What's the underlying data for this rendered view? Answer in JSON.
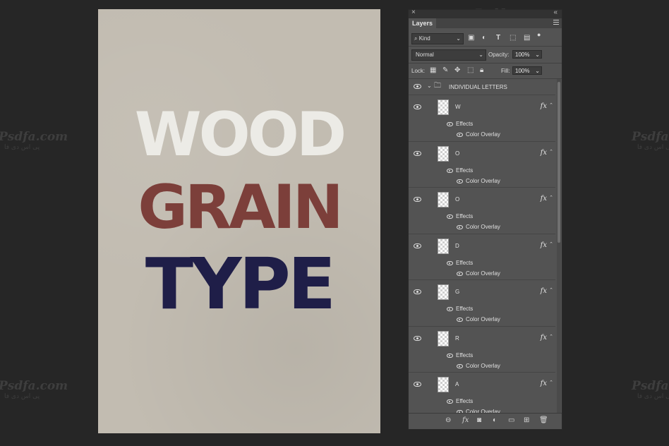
{
  "watermark": {
    "brand": "Psdfa.com",
    "sub": "پی اس دی فا"
  },
  "canvas": {
    "words": [
      "WOOD",
      "GRAIN",
      "TYPE"
    ],
    "colors": {
      "wood": "#ecebe6",
      "grain": "#7c3f3a",
      "type": "#1f1e48"
    }
  },
  "panel": {
    "close": "×",
    "collapse": "«",
    "tab": "Layers",
    "filter": {
      "label": "Kind",
      "icons": [
        "image-icon",
        "adjustment-icon",
        "type-icon",
        "shape-icon",
        "smartobject-icon",
        "toggle-icon"
      ]
    },
    "blend_mode": "Normal",
    "opacity_label": "Opacity:",
    "opacity_value": "100%",
    "lock_label": "Lock:",
    "fill_label": "Fill:",
    "fill_value": "100%",
    "group_name": "INDIVIDUAL LETTERS",
    "layers": [
      {
        "name": "W",
        "fx": "fx",
        "effects": "Effects",
        "effect_item": "Color Overlay"
      },
      {
        "name": "O",
        "fx": "fx",
        "effects": "Effects",
        "effect_item": "Color Overlay"
      },
      {
        "name": "O",
        "fx": "fx",
        "effects": "Effects",
        "effect_item": "Color Overlay"
      },
      {
        "name": "D",
        "fx": "fx",
        "effects": "Effects",
        "effect_item": "Color Overlay"
      },
      {
        "name": "G",
        "fx": "fx",
        "effects": "Effects",
        "effect_item": "Color Overlay"
      },
      {
        "name": "R",
        "fx": "fx",
        "effects": "Effects",
        "effect_item": "Color Overlay"
      },
      {
        "name": "A",
        "fx": "fx",
        "effects": "Effects",
        "effect_item": "Color Overlay"
      }
    ],
    "bottom_fx": "fx"
  }
}
